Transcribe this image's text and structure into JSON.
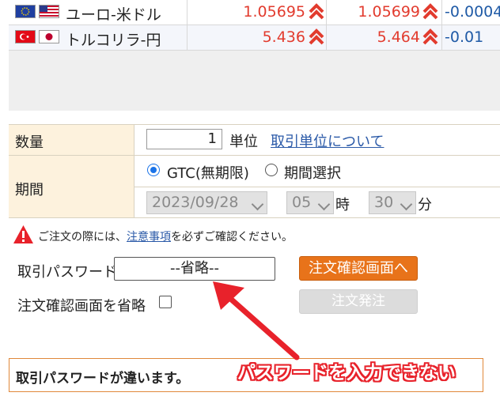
{
  "rates": {
    "rows": [
      {
        "pair": "ユーロ-米ドル",
        "bid": "1.05695",
        "ask": "1.05699",
        "change": "-0.0004",
        "flags": [
          "eu-flag",
          "us-flag"
        ]
      },
      {
        "pair": "トルコリラ-円",
        "bid": "5.436",
        "ask": "5.464",
        "change": "-0.01",
        "flags": [
          "tr-flag",
          "jp-flag"
        ]
      }
    ],
    "up_color": "#e23b2e",
    "change_color": "#1f5aa6"
  },
  "order": {
    "quantity_label": "数量",
    "quantity_value": "1",
    "unit": "単位",
    "unit_link": "取引単位について",
    "period_label": "期間",
    "gtc_label": "GTC(無期限)",
    "period_select_label": "期間選択",
    "date_value": "2023/09/28",
    "hour_value": "05",
    "hour_suffix": "時",
    "minute_value": "30",
    "minute_suffix": "分"
  },
  "notice": {
    "prefix": "ご注文の際には、",
    "link": "注意事項",
    "suffix": "を必ずご確認ください。"
  },
  "password": {
    "label": "取引パスワード",
    "value": "--省略--",
    "confirm_button": "注文確認画面へ",
    "skip_label": "注文確認画面を省略",
    "order_button": "注文発注"
  },
  "error": {
    "message": "取引パスワードが違います。"
  },
  "annotation": {
    "callout": "パスワードを入力できない",
    "color": "#e8222b"
  }
}
